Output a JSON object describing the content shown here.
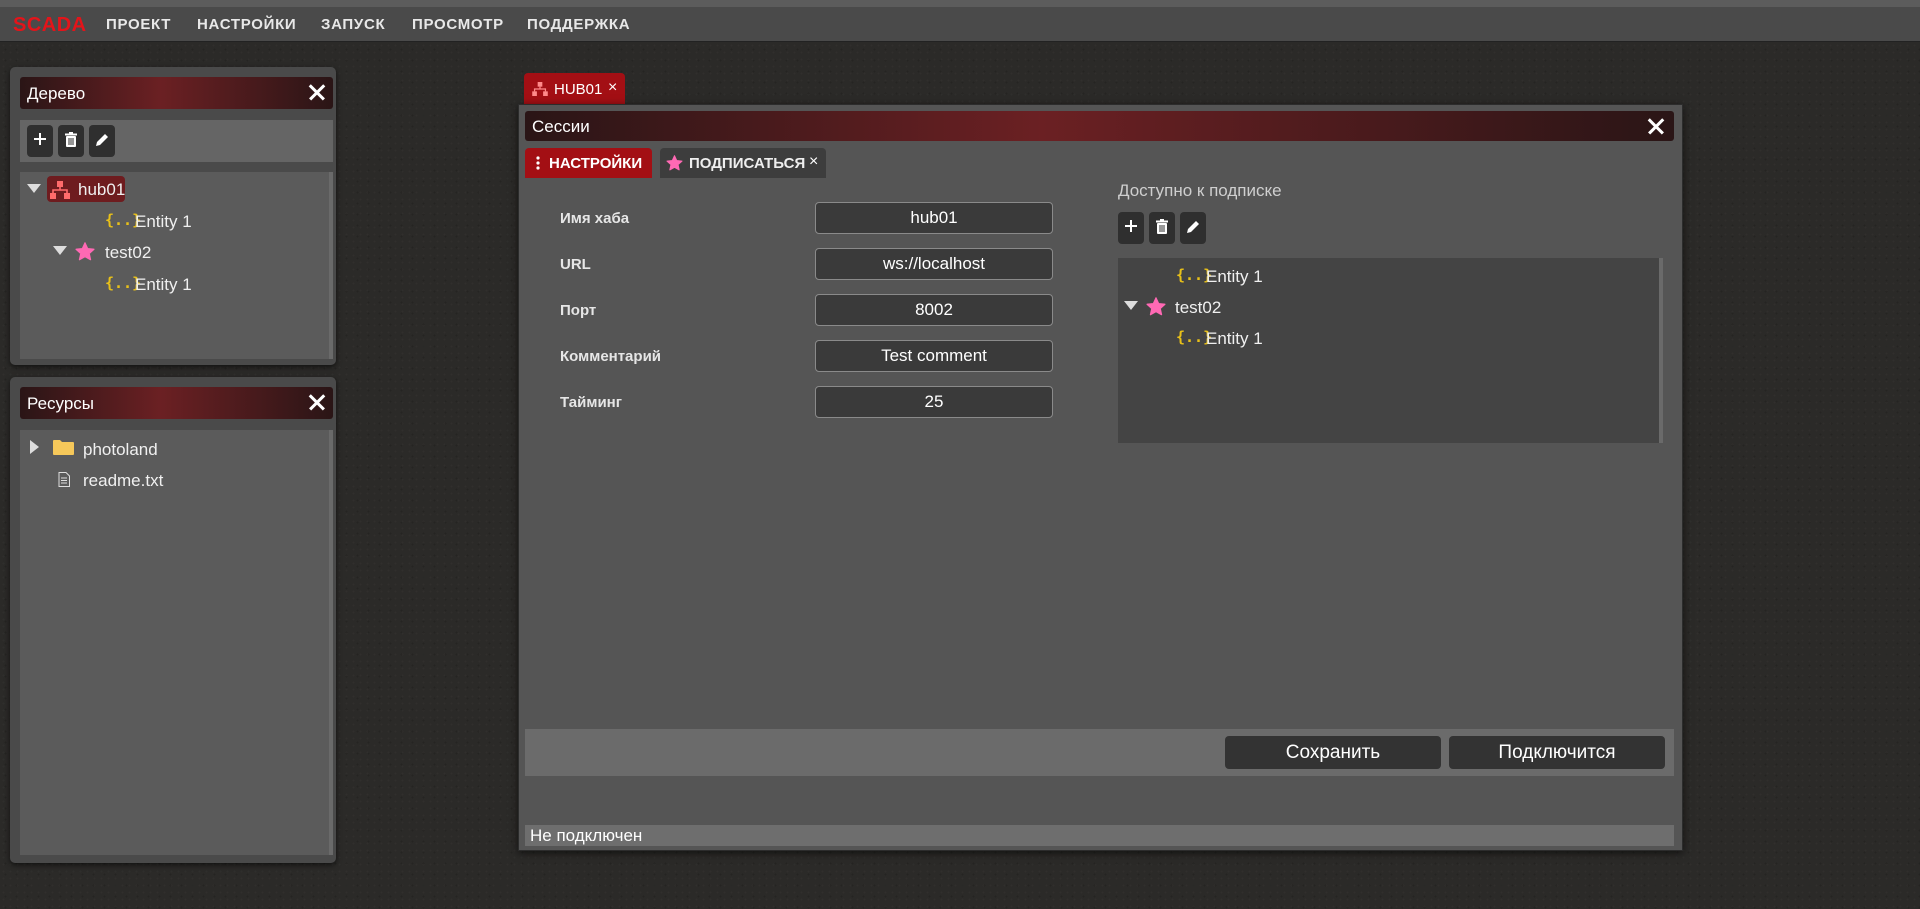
{
  "app": {
    "logo": "SCADA"
  },
  "menu": [
    "ПРОЕКТ",
    "НАСТРОЙКИ",
    "ЗАПУСК",
    "ПРОСМОТР",
    "ПОДДЕРЖКА"
  ],
  "tree_panel": {
    "title": "Дерево",
    "nodes": [
      {
        "label": "hub01",
        "icon": "hub-icon",
        "selected": true
      },
      {
        "label": "Entity 1",
        "icon": "entity-icon"
      },
      {
        "label": "test02",
        "icon": "star-icon"
      },
      {
        "label": "Entity 1",
        "icon": "entity-icon"
      }
    ]
  },
  "resources_panel": {
    "title": "Ресурсы",
    "items": [
      {
        "label": "photoland",
        "icon": "folder-icon"
      },
      {
        "label": "readme.txt",
        "icon": "file-icon"
      }
    ]
  },
  "doc_tab": {
    "label": "HUB01",
    "close": "×"
  },
  "sessions": {
    "title": "Сессии",
    "tabs": [
      {
        "label": "НАСТРОЙКИ",
        "active": true
      },
      {
        "label": "ПОДПИСАТЬСЯ",
        "close": "×"
      }
    ],
    "fields": [
      {
        "label": "Имя хаба",
        "value": "hub01"
      },
      {
        "label": "URL",
        "value": "ws://localhost"
      },
      {
        "label": "Порт",
        "value": "8002"
      },
      {
        "label": "Комментарий",
        "value": "Test comment"
      },
      {
        "label": "Тайминг",
        "value": "25"
      }
    ],
    "subscribe": {
      "title": "Доступно к подписке",
      "nodes": [
        {
          "label": "Entity 1",
          "icon": "entity-icon"
        },
        {
          "label": "test02",
          "icon": "star-icon"
        },
        {
          "label": "Entity 1",
          "icon": "entity-icon"
        }
      ]
    },
    "buttons": {
      "save": "Сохранить",
      "connect": "Подключится"
    },
    "status": "Не подключен"
  },
  "colors": {
    "accent": "#a30f14",
    "logo": "#e3141a",
    "star": "#ff69b4",
    "entity": "#e8c019"
  }
}
